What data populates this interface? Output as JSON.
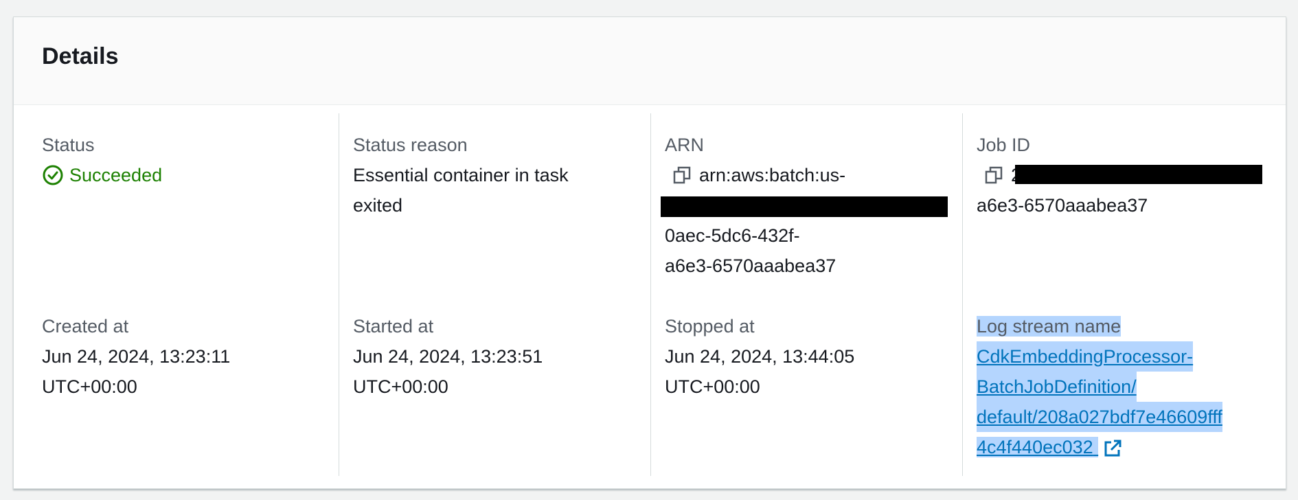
{
  "panel": {
    "title": "Details"
  },
  "fields": {
    "status": {
      "label": "Status",
      "value": "Succeeded"
    },
    "status_reason": {
      "label": "Status reason",
      "value_line1": "Essential container in task",
      "value_line2": "exited"
    },
    "arn": {
      "label": "ARN",
      "line1": "arn:aws:batch:us-",
      "line3": "0aec-5dc6-432f-",
      "line4": "a6e3-6570aaabea37"
    },
    "job_id": {
      "label": "Job ID",
      "line1_prefix": "2",
      "line2": "a6e3-6570aaabea37"
    },
    "created_at": {
      "label": "Created at",
      "line1": "Jun 24, 2024, 13:23:11",
      "line2": "UTC+00:00"
    },
    "started_at": {
      "label": "Started at",
      "line1": "Jun 24, 2024, 13:23:51",
      "line2": "UTC+00:00"
    },
    "stopped_at": {
      "label": "Stopped at",
      "line1": "Jun 24, 2024, 13:44:05",
      "line2": "UTC+00:00"
    },
    "log_stream": {
      "label": "Log stream name",
      "lines": [
        "CdkEmbeddingProcessor-",
        "BatchJobDefinition/",
        "default/208a027bdf7e46609fff",
        "4c4f440ec032"
      ]
    }
  },
  "icons": {
    "status": "status-positive-icon",
    "copy": "copy-icon",
    "external": "external-link-icon"
  },
  "colors": {
    "success": "#1d8102",
    "link": "#0073bb",
    "selection": "#b4d5fe"
  }
}
